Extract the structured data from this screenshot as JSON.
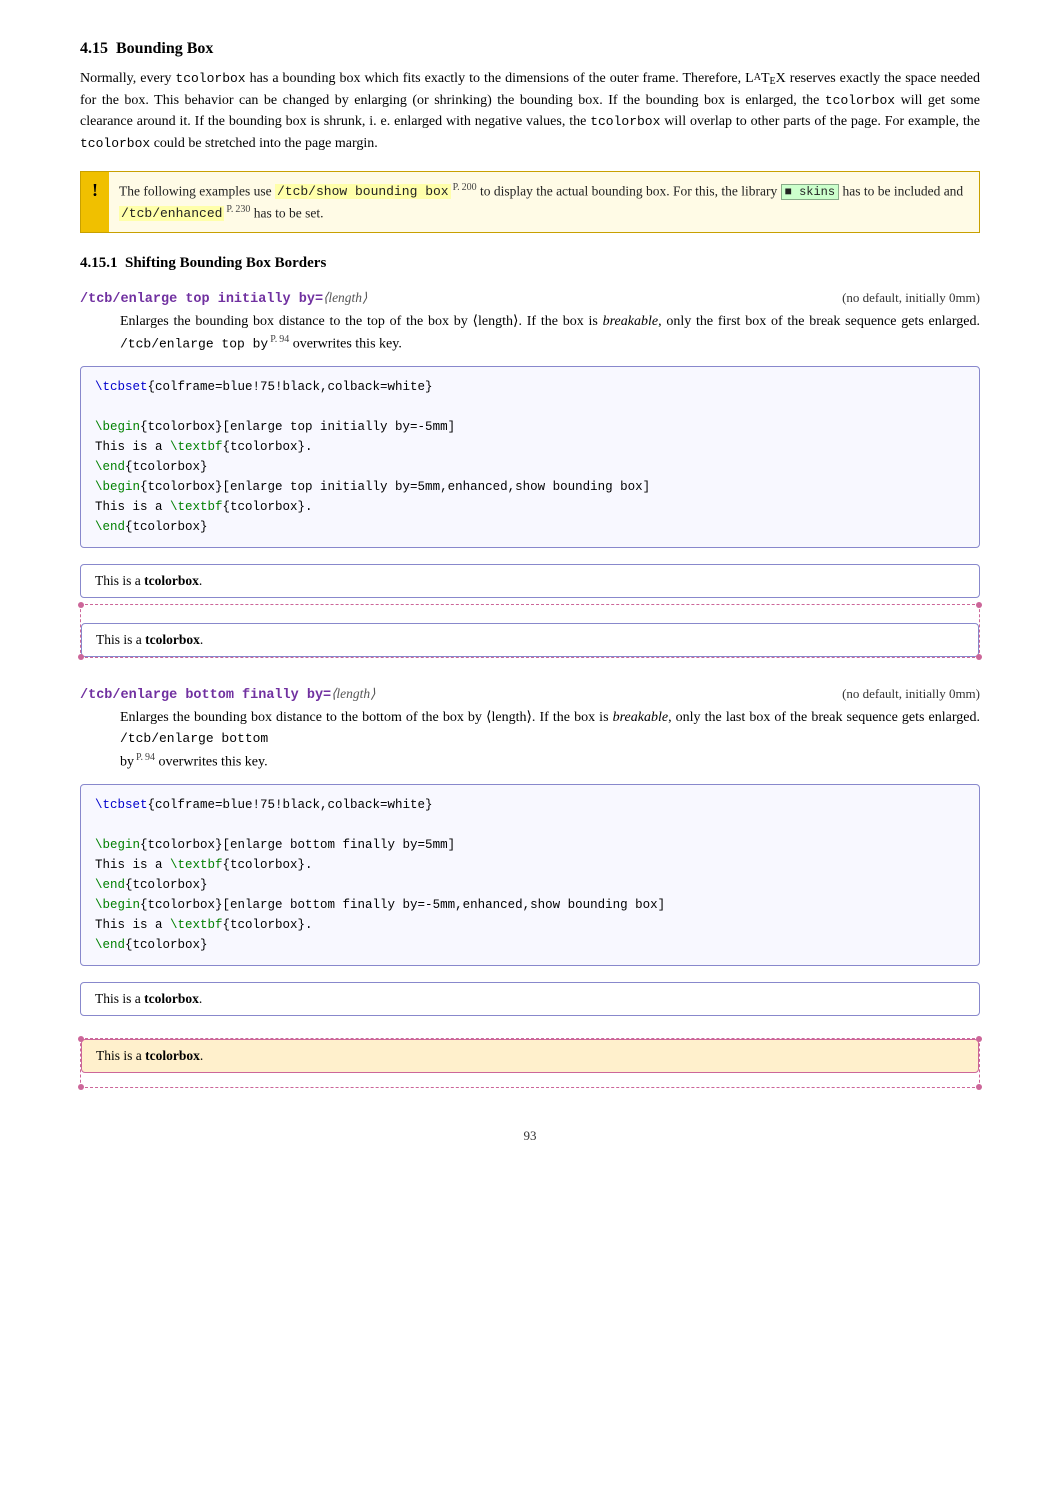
{
  "page": {
    "section": "4.15",
    "section_title": "Bounding Box",
    "subsection1": "4.15.1",
    "subsection1_title": "Shifting Bounding Box Borders",
    "page_number": "93",
    "intro_para": "Normally, every tcolorbox has a bounding box which fits exactly to the dimensions of the outer frame. Therefore, LATEX reserves exactly the space needed for the box. This behavior can be changed by enlarging (or shrinking) the bounding box. If the bounding box is enlarged, the tcolorbox will get some clearance around it. If the bounding box is shrunk, i. e. enlarged with negative values, the tcolorbox will overlap to other parts of the page. For example, the tcolorbox could be stretched into the page margin.",
    "warning": {
      "bang": "!",
      "text_before_code": "The following examples use",
      "code1": "/tcb/show bounding box",
      "page_ref1": "P. 200",
      "text_mid1": "to display the actual bounding box. For this, the library",
      "skins_badge": "skins",
      "text_mid2": "has to be included and",
      "code2": "/tcb/enhanced",
      "page_ref2": "P. 230",
      "text_after": "has to be set."
    },
    "key1": {
      "name": "/tcb/enlarge top initially by=",
      "param": "⟨length⟩",
      "default": "(no default, initially 0mm)",
      "desc1": "Enlarges the bounding box distance to the top of the box by ⟨length⟩. If the box is ",
      "desc_em": "breakable",
      "desc2": ", only the first box of the break sequence gets enlarged.",
      "code_ref": "/tcb/enlarge top by",
      "page_ref": "P. 94",
      "desc3": "overwrites this key.",
      "code_example": {
        "line1": "\\tcbset{colframe=blue!75!black,colback=white}",
        "line2": "",
        "line3": "\\begin{tcolorbox}[enlarge top initially by=-5mm]",
        "line4": "This is a \\textbf{tcolorbox}.",
        "line5": "\\end{tcolorbox}",
        "line6": "\\begin{tcolorbox}[enlarge top initially by=5mm,enhanced,show bounding box]",
        "line7": "This is a \\textbf{tcolorbox}.",
        "line8": "\\end{tcolorbox}"
      },
      "demo1_text": "This is a ",
      "demo1_bold": "tcolorbox",
      "demo1_suffix": ".",
      "demo2_text": "This is a ",
      "demo2_bold": "tcolorbox",
      "demo2_suffix": "."
    },
    "key2": {
      "name": "/tcb/enlarge bottom finally by=",
      "param": "⟨length⟩",
      "default": "(no default, initially 0mm)",
      "desc1": "Enlarges the bounding box distance to the bottom of the box by ⟨length⟩. If the box is ",
      "desc_em": "breakable",
      "desc2": ", only the last box of the break sequence gets enlarged.",
      "code_ref": "/tcb/enlarge bottom",
      "page_ref": "P. 94",
      "desc3": "overwrites this key.",
      "code_example": {
        "line1": "\\tcbset{colframe=blue!75!black,colback=white}",
        "line2": "",
        "line3": "\\begin{tcolorbox}[enlarge bottom finally by=5mm]",
        "line4": "This is a \\textbf{tcolorbox}.",
        "line5": "\\end{tcolorbox}",
        "line6": "\\begin{tcolorbox}[enlarge bottom finally by=-5mm,enhanced,show bounding box]",
        "line7": "This is a \\textbf{tcolorbox}.",
        "line8": "\\end{tcolorbox}"
      },
      "demo1_text": "This is a ",
      "demo1_bold": "tcolorbox",
      "demo1_suffix": ".",
      "demo2_text": "This is a ",
      "demo2_bold": "tcolorbox",
      "demo2_suffix": "."
    }
  }
}
